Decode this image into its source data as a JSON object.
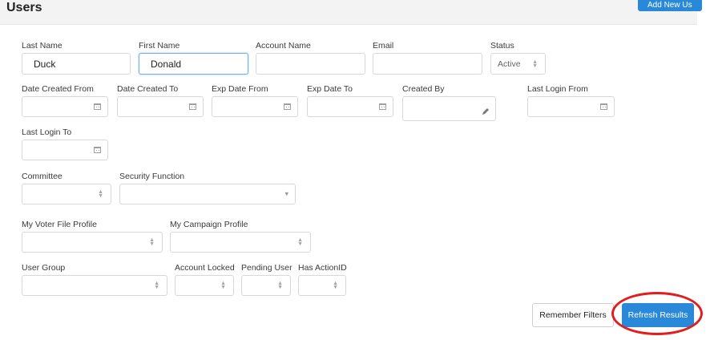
{
  "header": {
    "title": "Users",
    "add_button_label": "Add New Us"
  },
  "filters": {
    "last_name": {
      "label": "Last Name",
      "value": "Duck"
    },
    "first_name": {
      "label": "First Name",
      "value": "Donald"
    },
    "account_name": {
      "label": "Account Name",
      "value": ""
    },
    "email": {
      "label": "Email",
      "value": ""
    },
    "status": {
      "label": "Status",
      "value": "Active"
    },
    "date_created_from": {
      "label": "Date Created From",
      "value": ""
    },
    "date_created_to": {
      "label": "Date Created To",
      "value": ""
    },
    "exp_date_from": {
      "label": "Exp Date From",
      "value": ""
    },
    "exp_date_to": {
      "label": "Exp Date To",
      "value": ""
    },
    "created_by": {
      "label": "Created By",
      "value": ""
    },
    "last_login_from": {
      "label": "Last Login From",
      "value": ""
    },
    "last_login_to": {
      "label": "Last Login To",
      "value": ""
    },
    "committee": {
      "label": "Committee",
      "value": ""
    },
    "security_function": {
      "label": "Security Function",
      "value": ""
    },
    "voter_file_profile": {
      "label": "My Voter File Profile",
      "value": ""
    },
    "campaign_profile": {
      "label": "My Campaign Profile",
      "value": ""
    },
    "user_group": {
      "label": "User Group",
      "value": ""
    },
    "account_locked": {
      "label": "Account Locked",
      "value": ""
    },
    "pending_user": {
      "label": "Pending User",
      "value": ""
    },
    "has_action_id": {
      "label": "Has ActionID",
      "value": ""
    }
  },
  "actions": {
    "remember_label": "Remember Filters",
    "refresh_label": "Refresh Results"
  },
  "colors": {
    "primary": "#2a88d8",
    "highlight_ring": "#e11d1d"
  }
}
